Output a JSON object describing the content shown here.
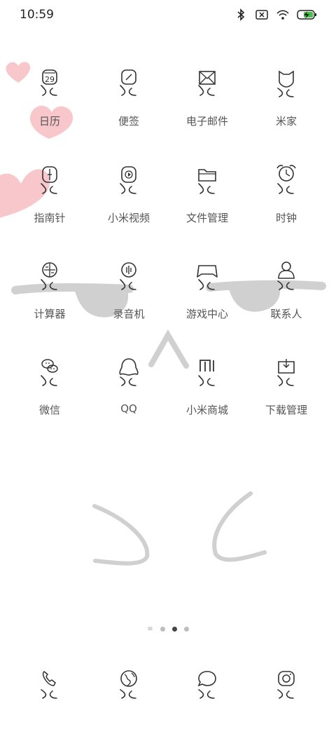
{
  "status_bar": {
    "time": "10:59",
    "icons": [
      "bluetooth-icon",
      "sim-error-icon",
      "wifi-icon",
      "battery-charging-icon"
    ]
  },
  "apps": [
    {
      "label": "日历",
      "icon": "calendar-icon",
      "badge": "29"
    },
    {
      "label": "便签",
      "icon": "notes-icon"
    },
    {
      "label": "电子邮件",
      "icon": "email-icon"
    },
    {
      "label": "米家",
      "icon": "mijia-icon"
    },
    {
      "label": "指南针",
      "icon": "compass-icon"
    },
    {
      "label": "小米视频",
      "icon": "video-icon"
    },
    {
      "label": "文件管理",
      "icon": "folder-icon"
    },
    {
      "label": "时钟",
      "icon": "alarm-clock-icon"
    },
    {
      "label": "计算器",
      "icon": "calculator-icon"
    },
    {
      "label": "录音机",
      "icon": "recorder-icon"
    },
    {
      "label": "游戏中心",
      "icon": "gamepad-icon"
    },
    {
      "label": "联系人",
      "icon": "contacts-icon"
    },
    {
      "label": "微信",
      "icon": "wechat-icon"
    },
    {
      "label": "QQ",
      "icon": "qq-icon"
    },
    {
      "label": "小米商城",
      "icon": "mi-store-icon"
    },
    {
      "label": "下载管理",
      "icon": "download-icon"
    }
  ],
  "page_indicator": {
    "menu_symbol": "≡",
    "pages": 3,
    "active_page": 2
  },
  "dock": [
    {
      "icon": "phone-icon"
    },
    {
      "icon": "browser-icon"
    },
    {
      "icon": "messages-icon"
    },
    {
      "icon": "camera-icon"
    }
  ],
  "colors": {
    "heart": "#f8c7cc",
    "stroke": "#333333",
    "wallpaper_gray": "#d4d4d4"
  }
}
